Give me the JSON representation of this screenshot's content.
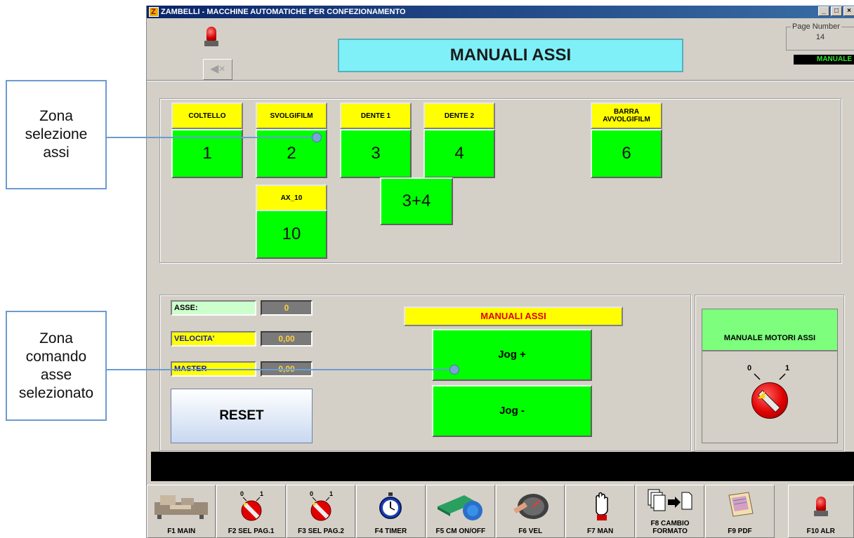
{
  "window": {
    "title": "ZAMBELLI - MACCHINE AUTOMATICHE PER CONFEZIONAMENTO",
    "controls": [
      "_",
      "□",
      "×"
    ]
  },
  "header": {
    "page_title": "MANUALI ASSI",
    "page_number_label": "Page Number",
    "page_number_value": "14",
    "mode_badge": "MANUALE",
    "mute_icon": "speaker-mute-icon"
  },
  "axes": [
    {
      "label": "COLTELLO",
      "number": "1"
    },
    {
      "label": "SVOLGIFILM",
      "number": "2"
    },
    {
      "label": "DENTE 1",
      "number": "3"
    },
    {
      "label": "DENTE 2",
      "number": "4"
    },
    {
      "label": "BARRA AVVOLGIFILM",
      "number": "6"
    },
    {
      "label": "AX_10",
      "number": "10"
    }
  ],
  "combo_axis": "3+4",
  "control": {
    "fields": [
      {
        "label": "ASSE:",
        "value": "0",
        "label_color": "#ccffcc"
      },
      {
        "label": "VELOCITA'",
        "value": "0,00",
        "label_color": "#ffff00"
      },
      {
        "label": "MASTER",
        "value": "0,00",
        "label_color": "#ffff00"
      }
    ],
    "reset_label": "RESET",
    "manual_title": "MANUALI ASSI",
    "jog_plus": "Jog +",
    "jog_minus": "Jog -"
  },
  "motor": {
    "title": "MANUALE MOTORI ASSI",
    "selector_off": "0",
    "selector_on": "1"
  },
  "fkeys": [
    {
      "label": "F1 MAIN",
      "icon": "machine-icon"
    },
    {
      "label": "F2 SEL PAG.1",
      "icon": "selector-icon"
    },
    {
      "label": "F3 SEL PAG.2",
      "icon": "selector-icon"
    },
    {
      "label": "F4 TIMER",
      "icon": "stopwatch-icon"
    },
    {
      "label": "F5 CM ON/OFF",
      "icon": "roller-icon"
    },
    {
      "label": "F6 VEL",
      "icon": "speedometer-icon"
    },
    {
      "label": "F7 MAN",
      "icon": "hand-icon"
    },
    {
      "label": "F8 CAMBIO FORMATO",
      "icon": "format-change-icon"
    },
    {
      "label": "F9 PDF",
      "icon": "document-icon"
    },
    {
      "label": "F10 ALR",
      "icon": "alarm-siren-icon"
    }
  ],
  "annotations": [
    {
      "text": "Zona selezione assi"
    },
    {
      "text": "Zona comando asse selezionato"
    }
  ],
  "colors": {
    "axis_label": "#ffff00",
    "axis_button": "#00ff00",
    "title_bg": "#7ff0f8",
    "annotation_border": "#6b9bd1"
  }
}
